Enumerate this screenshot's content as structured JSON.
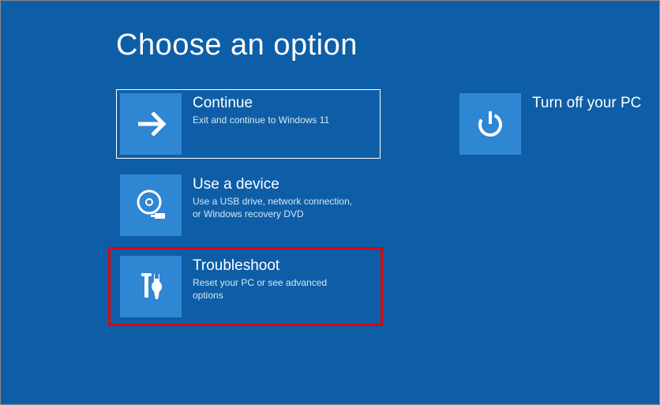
{
  "title": "Choose an option",
  "options": {
    "continue": {
      "title": "Continue",
      "desc": "Exit and continue to Windows 11"
    },
    "turn_off": {
      "title": "Turn off your PC"
    },
    "use_device": {
      "title": "Use a device",
      "desc": "Use a USB drive, network connection, or Windows recovery DVD"
    },
    "troubleshoot": {
      "title": "Troubleshoot",
      "desc": "Reset your PC or see advanced options"
    }
  },
  "colors": {
    "background": "#0e5ea7",
    "tile": "#2f86d3",
    "highlight": "#e30000"
  }
}
